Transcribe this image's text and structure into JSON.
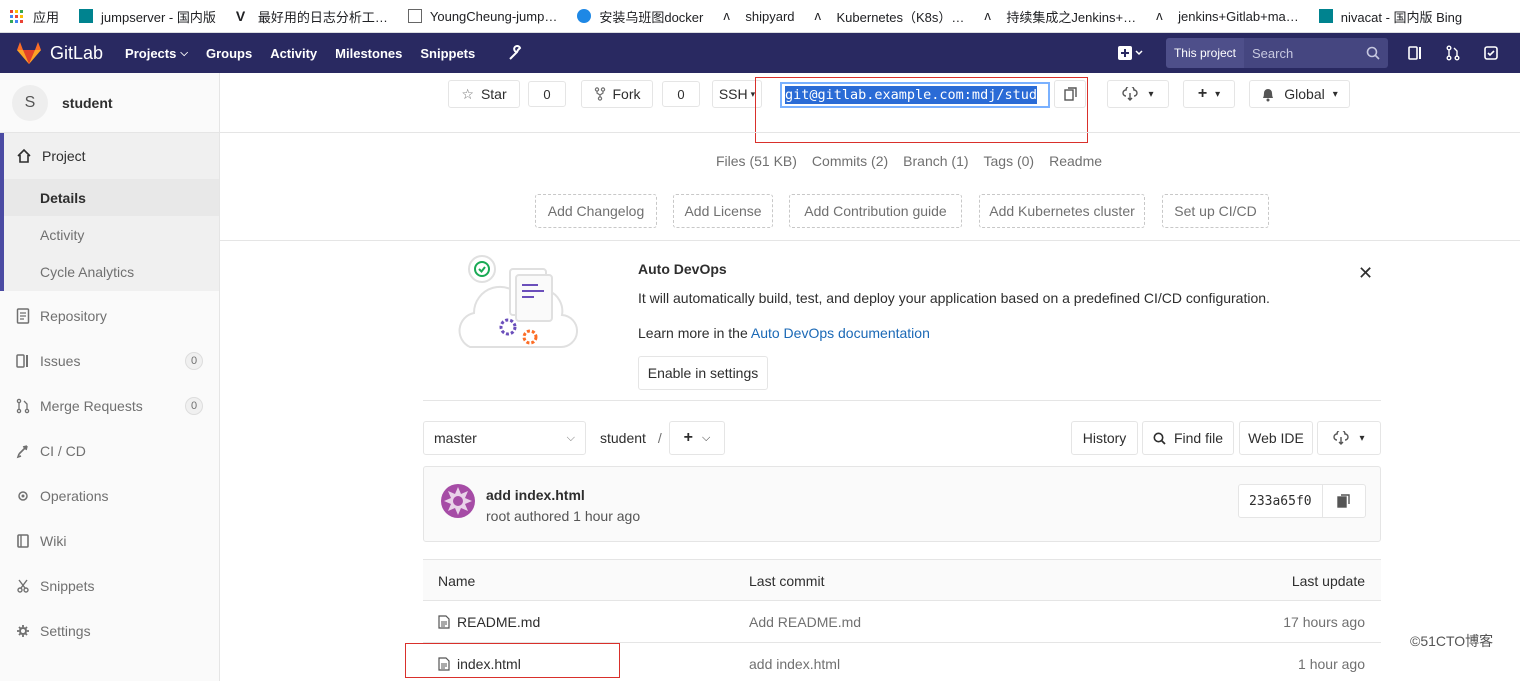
{
  "bookmarks": [
    {
      "label": "应用",
      "color": "#ea4335"
    },
    {
      "label": "jumpserver - 国内版",
      "color": "#00838f"
    },
    {
      "label": "最好用的日志分析工…",
      "color": "#000000"
    },
    {
      "label": "YoungCheung-jump…",
      "color": "#666666"
    },
    {
      "label": "安装乌班图docker",
      "color": "#1e88e5"
    },
    {
      "label": "shipyard",
      "color": "#333333"
    },
    {
      "label": "Kubernetes（K8s）…",
      "color": "#333333"
    },
    {
      "label": "持续集成之Jenkins+…",
      "color": "#333333"
    },
    {
      "label": "jenkins+Gitlab+ma…",
      "color": "#333333"
    },
    {
      "label": "nivacat - 国内版 Bing",
      "color": "#00838f"
    }
  ],
  "navbar": {
    "brand": "GitLab",
    "items": [
      "Projects",
      "Groups",
      "Activity",
      "Milestones",
      "Snippets"
    ],
    "this_project": "This project",
    "search_placeholder": "Search"
  },
  "sidebar": {
    "avatar_letter": "S",
    "project_name": "student",
    "project_label": "Project",
    "sub_items": [
      "Details",
      "Activity",
      "Cycle Analytics"
    ],
    "items": [
      {
        "label": "Repository",
        "icon": "doc-icon"
      },
      {
        "label": "Issues",
        "icon": "issues-icon",
        "count": "0"
      },
      {
        "label": "Merge Requests",
        "icon": "merge-icon",
        "count": "0"
      },
      {
        "label": "CI / CD",
        "icon": "rocket-icon"
      },
      {
        "label": "Operations",
        "icon": "cloud-gear-icon"
      },
      {
        "label": "Wiki",
        "icon": "book-icon"
      },
      {
        "label": "Snippets",
        "icon": "scissors-icon"
      },
      {
        "label": "Settings",
        "icon": "gear-icon"
      }
    ]
  },
  "actions": {
    "star": "Star",
    "star_count": "0",
    "fork": "Fork",
    "fork_count": "0",
    "protocol": "SSH",
    "clone_url": "git@gitlab.example.com:mdj/stud",
    "notification": "Global"
  },
  "stats": [
    "Files (51 KB)",
    "Commits (2)",
    "Branch (1)",
    "Tags (0)",
    "Readme"
  ],
  "quick_links": [
    "Add Changelog",
    "Add License",
    "Add Contribution guide",
    "Add Kubernetes cluster",
    "Set up CI/CD"
  ],
  "devops": {
    "title": "Auto DevOps",
    "description": "It will automatically build, test, and deploy your application based on a predefined CI/CD configuration.",
    "learn_prefix": "Learn more in the ",
    "learn_link": "Auto DevOps documentation",
    "enable_button": "Enable in settings"
  },
  "repo": {
    "branch": "master",
    "path": "student",
    "separator": "/",
    "history": "History",
    "find_file": "Find file",
    "web_ide": "Web IDE"
  },
  "commit": {
    "title": "add index.html",
    "author": "root authored 1 hour ago",
    "sha": "233a65f0"
  },
  "table": {
    "headers": [
      "Name",
      "Last commit",
      "Last update"
    ],
    "rows": [
      {
        "name": "README.md",
        "commit": "Add README.md",
        "updated": "17 hours ago"
      },
      {
        "name": "index.html",
        "commit": "add index.html",
        "updated": "1 hour ago"
      }
    ]
  },
  "watermark": "©51CTO博客"
}
